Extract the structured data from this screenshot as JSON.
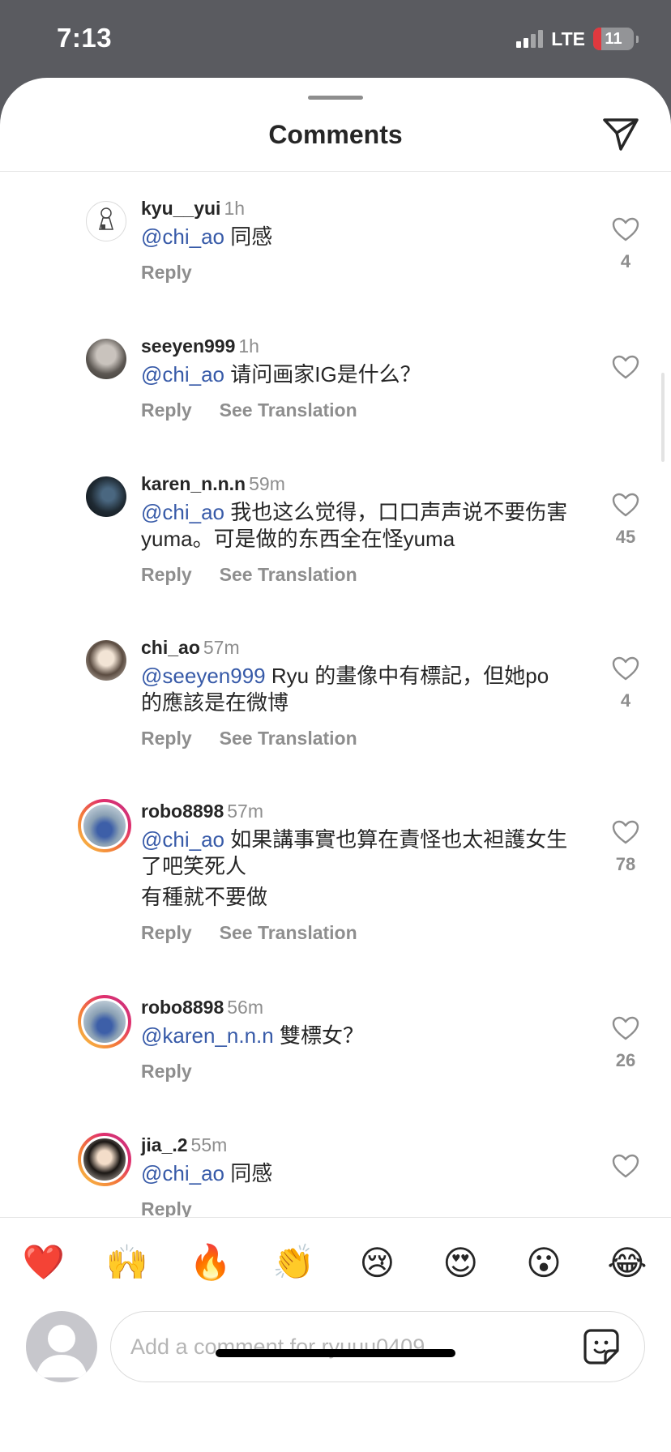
{
  "status": {
    "time": "7:13",
    "network": "LTE",
    "battery": "11"
  },
  "header": {
    "title": "Comments",
    "share_icon": "paper-plane-icon"
  },
  "comments": [
    {
      "username": "kyu__yui",
      "time": "1h",
      "mention": "@chi_ao",
      "text": " 同感",
      "extra": "",
      "reply": "Reply",
      "translate": "",
      "likes": "4"
    },
    {
      "username": "seeyen999",
      "time": "1h",
      "mention": "@chi_ao",
      "text": " 请问画家IG是什么？",
      "extra": "",
      "reply": "Reply",
      "translate": "See Translation",
      "likes": ""
    },
    {
      "username": "karen_n.n.n",
      "time": "59m",
      "mention": "@chi_ao",
      "text": " 我也这么觉得，口口声声说不要伤害yuma。可是做的东西全在怪yuma",
      "extra": "",
      "reply": "Reply",
      "translate": "See Translation",
      "likes": "45"
    },
    {
      "username": "chi_ao",
      "time": "57m",
      "mention": "@seeyen999",
      "text": " Ryu 的畫像中有標記，但她po 的應該是在微博",
      "extra": "",
      "reply": "Reply",
      "translate": "See Translation",
      "likes": "4"
    },
    {
      "username": "robo8898",
      "time": "57m",
      "mention": "@chi_ao",
      "text": " 如果講事實也算在責怪也太袒護女生了吧笑死人",
      "extra": "有種就不要做",
      "reply": "Reply",
      "translate": "See Translation",
      "likes": "78"
    },
    {
      "username": "robo8898",
      "time": "56m",
      "mention": "@karen_n.n.n",
      "text": " 雙標女？",
      "extra": "",
      "reply": "Reply",
      "translate": "",
      "likes": "26"
    },
    {
      "username": "jia_.2",
      "time": "55m",
      "mention": "@chi_ao",
      "text": " 同感",
      "extra": "",
      "reply": "Reply",
      "translate": "",
      "likes": ""
    }
  ],
  "reactions": [
    "❤️",
    "🙌",
    "🔥",
    "👏",
    "😢",
    "😍",
    "😮",
    "😂"
  ],
  "composer": {
    "placeholder": "Add a comment for ryuuu0409...",
    "sticker_icon": "sticker-icon"
  },
  "colors": {
    "mention": "#375aa8",
    "muted": "#8e8e8e",
    "text": "#262626"
  }
}
